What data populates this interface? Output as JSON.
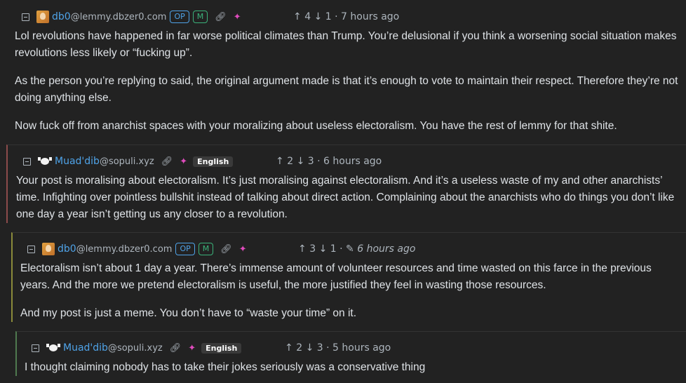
{
  "comments": [
    {
      "user": "db0",
      "instance": "@lemmy.dbzer0.com",
      "badges": [
        "OP",
        "M"
      ],
      "upvotes": "4",
      "downvotes": "1",
      "time": "7 hours ago",
      "paragraphs": [
        "Lol revolutions have happened in far worse political climates than Trump. You’re delusional if you think a worsening social situation makes revolutions less likely or “fucking up”.",
        "As the person you’re replying to said, the original argument made is that it’s enough to vote to maintain their respect. Therefore they’re not doing anything else.",
        "Now fuck off from anarchist spaces with your moralizing about useless electoralism. You have the rest of lemmy for that shite."
      ]
    },
    {
      "user": "Muad'dib",
      "instance": "@sopuli.xyz",
      "language": "English",
      "upvotes": "2",
      "downvotes": "3",
      "time": "6 hours ago",
      "paragraphs": [
        "Your post is moralising about electoralism. It’s just moralising against electoralism. And it’s a useless waste of my and other anarchists’ time. Infighting over pointless bullshit instead of talking about direct action. Complaining about the anarchists who do things you don’t like one day a year isn’t getting us any closer to a revolution."
      ]
    },
    {
      "user": "db0",
      "instance": "@lemmy.dbzer0.com",
      "badges": [
        "OP",
        "M"
      ],
      "upvotes": "3",
      "downvotes": "1",
      "time": "6 hours ago",
      "paragraphs": [
        "Electoralism isn’t about 1 day a year. There’s immense amount of volunteer resources and time wasted on this farce in the previous years. And the more we pretend electoralism is useful, the more justified they feel in wasting those resources.",
        "And my post is just a meme. You don’t have to “waste your time” on it."
      ]
    },
    {
      "user": "Muad'dib",
      "instance": "@sopuli.xyz",
      "language": "English",
      "upvotes": "2",
      "downvotes": "3",
      "time": "5 hours ago",
      "paragraphs": [
        "I thought claiming nobody has to take their jokes seriously was a conservative thing"
      ]
    }
  ],
  "colors": {
    "link": "#4fa3e8",
    "mod": "#3bb27a",
    "background": "#222222"
  },
  "icons": [
    "collapse-icon",
    "link-icon",
    "fediverse-icon",
    "edit-icon",
    "upvote-icon",
    "downvote-icon"
  ]
}
